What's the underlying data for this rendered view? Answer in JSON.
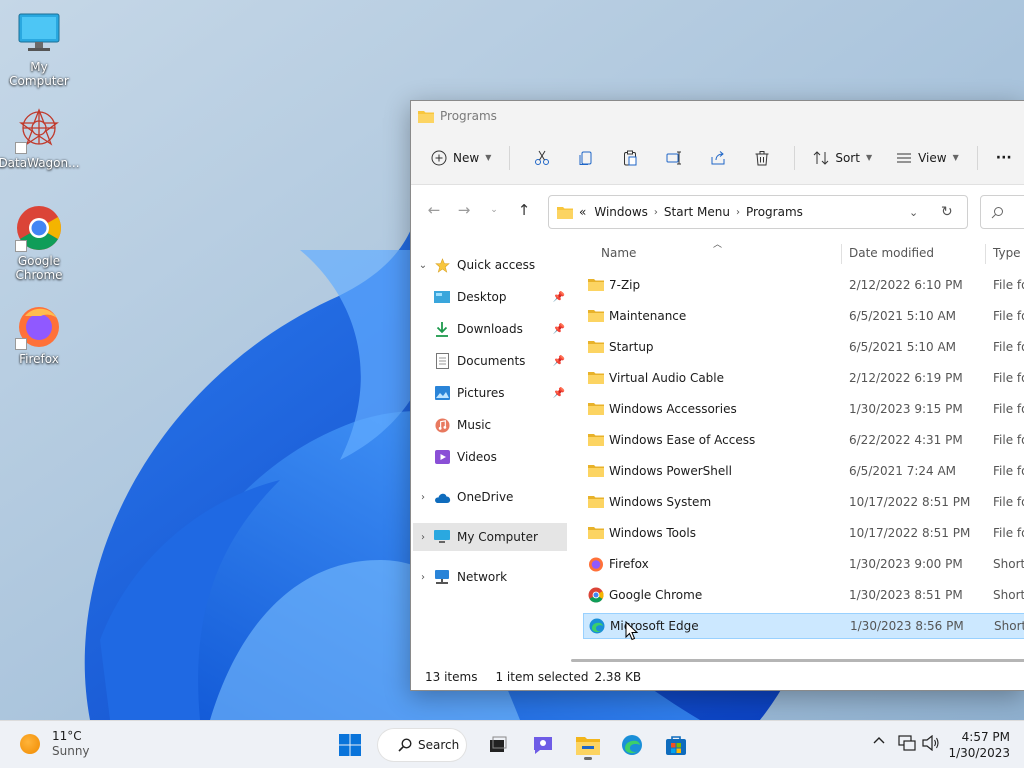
{
  "desktop": {
    "icons": [
      {
        "label": "My Computer"
      },
      {
        "label": "DataWagon..."
      },
      {
        "label": "Google\nChrome"
      },
      {
        "label": "Firefox"
      }
    ]
  },
  "window": {
    "title": "Programs",
    "toolbar": {
      "new_label": "New",
      "sort_label": "Sort",
      "view_label": "View",
      "more_label": "···"
    },
    "address": {
      "overflow": "«",
      "crumbs": [
        "Windows",
        "Start Menu",
        "Programs"
      ]
    },
    "nav": {
      "quick_access": "Quick access",
      "desktop": "Desktop",
      "downloads": "Downloads",
      "documents": "Documents",
      "pictures": "Pictures",
      "music": "Music",
      "videos": "Videos",
      "onedrive": "OneDrive",
      "my_computer": "My Computer",
      "network": "Network"
    },
    "columns": {
      "name": "Name",
      "date": "Date modified",
      "type": "Type"
    },
    "files": [
      {
        "name": "7-Zip",
        "date": "2/12/2022 6:10 PM",
        "type": "File fo"
      },
      {
        "name": "Maintenance",
        "date": "6/5/2021 5:10 AM",
        "type": "File fo"
      },
      {
        "name": "Startup",
        "date": "6/5/2021 5:10 AM",
        "type": "File fo"
      },
      {
        "name": "Virtual Audio Cable",
        "date": "2/12/2022 6:19 PM",
        "type": "File fo"
      },
      {
        "name": "Windows Accessories",
        "date": "1/30/2023 9:15 PM",
        "type": "File fo"
      },
      {
        "name": "Windows Ease of Access",
        "date": "6/22/2022 4:31 PM",
        "type": "File fo"
      },
      {
        "name": "Windows PowerShell",
        "date": "6/5/2021 7:24 AM",
        "type": "File fo"
      },
      {
        "name": "Windows System",
        "date": "10/17/2022 8:51 PM",
        "type": "File fo"
      },
      {
        "name": "Windows Tools",
        "date": "10/17/2022 8:51 PM",
        "type": "File fo"
      },
      {
        "name": "Firefox",
        "date": "1/30/2023 9:00 PM",
        "type": "Shorte"
      },
      {
        "name": "Google Chrome",
        "date": "1/30/2023 8:51 PM",
        "type": "Shorte"
      },
      {
        "name": "Microsoft Edge",
        "date": "1/30/2023 8:56 PM",
        "type": "Shorte"
      }
    ],
    "status": {
      "items": "13 items",
      "selected": "1 item selected",
      "size": "2.38 KB"
    }
  },
  "taskbar": {
    "weather_temp": "11°C",
    "weather_desc": "Sunny",
    "search_label": "Search",
    "time": "4:57 PM",
    "date": "1/30/2023"
  },
  "colors": {
    "accent": "#0067c0",
    "folder": "#f8c63d",
    "selection": "#cce8ff"
  }
}
